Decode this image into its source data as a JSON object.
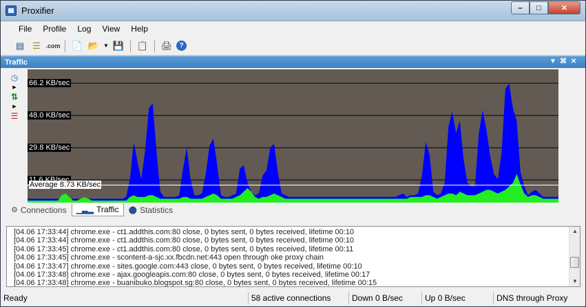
{
  "window": {
    "title": "Proxifier"
  },
  "menu": {
    "items": [
      "File",
      "Profile",
      "Log",
      "View",
      "Help"
    ]
  },
  "panel": {
    "title": "Traffic"
  },
  "chart_data": {
    "type": "area",
    "title": "",
    "xlabel": "",
    "ylabel": "",
    "ylim": [
      0,
      74
    ],
    "tick_labels": [
      "66.2 KB/sec",
      "48.0 KB/sec",
      "29.8 KB/sec",
      "11.6 KB/sec"
    ],
    "tick_values": [
      66.2,
      48.0,
      29.8,
      11.6
    ],
    "average": {
      "label": "Average 8.73 KB/sec",
      "value": 8.73
    },
    "grid": true,
    "series": [
      {
        "color": "#0000ff",
        "values": [
          1,
          1,
          1,
          1,
          1,
          1,
          1,
          1,
          1,
          1,
          1,
          1,
          1,
          1,
          1,
          1,
          1,
          1,
          1,
          1,
          1,
          1,
          1,
          1,
          1,
          1,
          2,
          12,
          33,
          22,
          12,
          28,
          52,
          55,
          28,
          5,
          2,
          2,
          2,
          2,
          3,
          18,
          30,
          12,
          3,
          3,
          4,
          15,
          31,
          35,
          20,
          3,
          2,
          2,
          3,
          4,
          18,
          20,
          10,
          5,
          3,
          4,
          14,
          17,
          30,
          32,
          16,
          4,
          3,
          2,
          2,
          2,
          2,
          2,
          2,
          2,
          2,
          2,
          2,
          2,
          2,
          2,
          2,
          2,
          2,
          2,
          2,
          2,
          2,
          2,
          2,
          2,
          2,
          2,
          2,
          2,
          2,
          2,
          3,
          4,
          2,
          3,
          3,
          4,
          14,
          33,
          26,
          5,
          3,
          4,
          10,
          42,
          50,
          38,
          45,
          23,
          10,
          8,
          8,
          38,
          51,
          40,
          25,
          15,
          12,
          27,
          63,
          66,
          52,
          45,
          16,
          8,
          3,
          5,
          6,
          4,
          2,
          2,
          2,
          2,
          2
        ]
      },
      {
        "color": "#22ee22",
        "values": [
          0,
          0,
          0,
          0,
          0,
          0,
          0,
          0,
          0,
          3,
          4,
          2,
          0,
          0,
          1,
          2,
          1,
          0,
          0,
          0,
          0,
          0,
          0,
          0,
          0,
          0,
          0,
          2,
          3,
          2,
          2,
          2,
          3,
          3,
          2,
          1,
          1,
          1,
          1,
          1,
          1,
          2,
          2,
          1,
          1,
          1,
          1,
          2,
          3,
          4,
          3,
          1,
          1,
          1,
          1,
          2,
          3,
          5,
          7,
          5,
          2,
          1,
          2,
          2,
          3,
          4,
          3,
          2,
          1,
          1,
          1,
          1,
          1,
          1,
          1,
          1,
          1,
          1,
          1,
          1,
          1,
          1,
          1,
          1,
          1,
          1,
          1,
          1,
          1,
          1,
          1,
          1,
          1,
          1,
          1,
          1,
          1,
          1,
          1,
          1,
          1,
          2,
          2,
          2,
          2,
          3,
          3,
          2,
          1,
          2,
          3,
          4,
          4,
          3,
          5,
          4,
          3,
          3,
          3,
          4,
          5,
          6,
          6,
          5,
          4,
          5,
          6,
          8,
          10,
          15,
          9,
          4,
          2,
          3,
          3,
          2,
          1,
          1,
          1,
          1,
          1
        ]
      }
    ]
  },
  "tabs": [
    {
      "label": "Connections",
      "icon": "connections-icon",
      "active": false
    },
    {
      "label": "Traffic",
      "icon": "traffic-icon",
      "active": true
    },
    {
      "label": "Statistics",
      "icon": "statistics-icon",
      "active": false
    }
  ],
  "log": {
    "lines": [
      "[04.06 17:33:44] chrome.exe - ct1.addthis.com:80 close, 0 bytes sent, 0 bytes received, lifetime 00:10",
      "[04.06 17:33:44] chrome.exe - ct1.addthis.com:80 close, 0 bytes sent, 0 bytes received, lifetime 00:10",
      "[04.06 17:33:45] chrome.exe - ct1.addthis.com:80 close, 0 bytes sent, 0 bytes received, lifetime 00:11",
      "[04.06 17:33:45] chrome.exe - scontent-a-sjc.xx.fbcdn.net:443 open through oke proxy chain",
      "[04.06 17:33:47] chrome.exe - sites.google.com:443 close, 0 bytes sent, 0 bytes received, lifetime 00:10",
      "[04.06 17:33:48] chrome.exe - ajax.googleapis.com:80 close, 0 bytes sent, 0 bytes received, lifetime 00:17",
      "[04.06 17:33:48] chrome.exe - buanibuko.blogspot.sg:80 close, 0 bytes sent, 0 bytes received, lifetime 00:15"
    ]
  },
  "status": {
    "ready": "Ready",
    "connections": "58 active connections",
    "down": "Down 0 B/sec",
    "up": "Up 0 B/sec",
    "dns": "DNS through Proxy"
  }
}
